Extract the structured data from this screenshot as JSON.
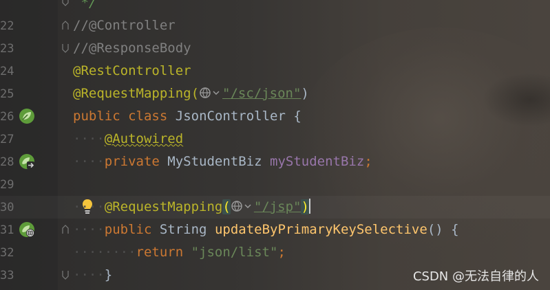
{
  "editor": {
    "lines": [
      {
        "num": "",
        "text": " */"
      },
      {
        "num": "22",
        "text": "//@Controller"
      },
      {
        "num": "23",
        "text": "//@ResponseBody"
      },
      {
        "num": "24",
        "text": "@RestController"
      },
      {
        "num": "25",
        "a": "@RequestMapping(",
        "b": "\"/sc/json\"",
        "c": ")"
      },
      {
        "num": "26",
        "kw1": "public",
        "kw2": "class",
        "name": "JsonController",
        "rest": " {"
      },
      {
        "num": "27",
        "ann": "@Autowired"
      },
      {
        "num": "28",
        "kw": "private",
        "type": "MyStudentBiz",
        "field": "myStudentBiz",
        "end": ";"
      },
      {
        "num": "29"
      },
      {
        "num": "30",
        "a": "@RequestMapping",
        "p1": "(",
        "b": "\"/jsp\"",
        "p2": ")"
      },
      {
        "num": "31",
        "kw": "public",
        "type": "String",
        "method": "updateByPrimaryKeySelective",
        "rest": "() {"
      },
      {
        "num": "32",
        "kw": "return",
        "str": "\"json/list\"",
        "end": ";"
      },
      {
        "num": "33",
        "text": "}"
      }
    ]
  },
  "gutter_icons": {
    "line26": "spring-bean-icon",
    "line28": "spring-autowired-icon",
    "line31": "spring-web-endpoint-icon",
    "line30": "intention-bulb-icon"
  },
  "colors": {
    "keyword": "#cc7832",
    "annotation": "#bbb529",
    "string": "#6a8759",
    "field": "#9876aa",
    "method": "#ffc66d",
    "comment": "#808080"
  },
  "watermark": "CSDN @无法自律的人"
}
